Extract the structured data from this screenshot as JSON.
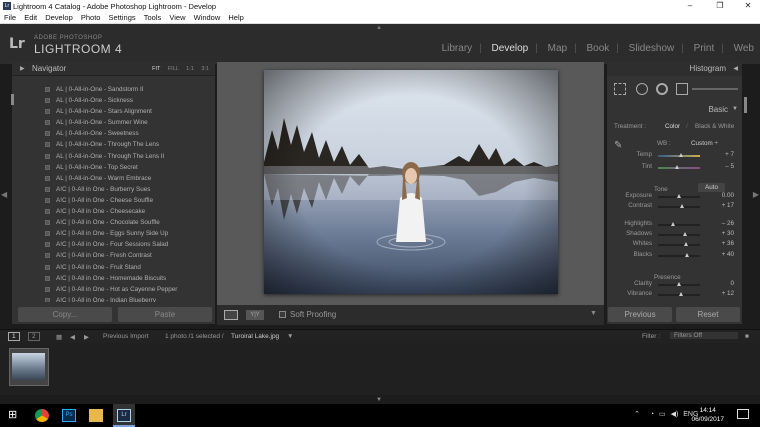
{
  "window": {
    "title": "Lightroom 4 Catalog - Adobe Photoshop Lightroom - Develop",
    "minimize": "–",
    "maximize": "❐",
    "close": "✕"
  },
  "menu": [
    "File",
    "Edit",
    "Develop",
    "Photo",
    "Settings",
    "Tools",
    "View",
    "Window",
    "Help"
  ],
  "identity": {
    "logo": "Lr",
    "brand": "ADOBE PHOTOSHOP",
    "product": "LIGHTROOM 4"
  },
  "modules": [
    "Library",
    "Develop",
    "Map",
    "Book",
    "Slideshow",
    "Print",
    "Web"
  ],
  "active_module": "Develop",
  "navigator": {
    "title": "Navigator",
    "zoom": [
      "FIT",
      "FILL",
      "1:1",
      "3:1"
    ]
  },
  "presets": [
    "AL | 0-All-in-One - Sandstorm II",
    "AL | 0-All-in-One - Sickness",
    "AL | 0-All-in-One - Stars Alignment",
    "AL | 0-All-in-One - Summer Wine",
    "AL | 0-All-in-One - Sweetness",
    "AL | 0-All-in-One - Through The Lens",
    "AL | 0-All-in-One - Through The Lens II",
    "AL | 0-All-in-One - Top Secret",
    "AL | 0-All-in-One - Warm Embrace",
    "A!C | 0-All in One - Burberry Sues",
    "A!C | 0-All in One - Cheese Souffle",
    "A!C | 0-All in One - Cheesecake",
    "A!C | 0-All in One - Chocolate Souffle",
    "A!C | 0-All in One - Eggs Sunny Side Up",
    "A!C | 0-All in One - Four Sessions Salad",
    "A!C | 0-All in One - Fresh Contrast",
    "A!C | 0-All in One - Fruit Stand",
    "A!C | 0-All in One - Homemade Biscuits",
    "A!C | 0-All in One - Hot as Cayenne Pepper",
    "A!C | 0-All in One - Indian Blueberry"
  ],
  "left_buttons": {
    "copy": "Copy...",
    "paste": "Paste"
  },
  "toolbar": {
    "soft_proofing": "Soft Proofing",
    "yy": "Y|Y"
  },
  "histogram": {
    "title": "Histogram"
  },
  "basic": {
    "title": "Basic",
    "treatment_label": "Treatment :",
    "treatment_color": "Color",
    "treatment_bw": "Black & White",
    "wb_label": "WB :",
    "wb_value": "Custom ÷",
    "tone_label": "Tone",
    "auto": "Auto",
    "presence_label": "Presence"
  },
  "sliders": [
    {
      "label": "Temp",
      "value": "+ 7",
      "pos": 0.55,
      "style": "wb"
    },
    {
      "label": "Tint",
      "value": "– 5",
      "pos": 0.47,
      "style": "tint"
    },
    {
      "label": "Exposure",
      "value": "0.00",
      "pos": 0.5,
      "style": ""
    },
    {
      "label": "Contrast",
      "value": "+ 17",
      "pos": 0.58,
      "style": ""
    },
    {
      "label": "Highlights",
      "value": "– 26",
      "pos": 0.37,
      "style": ""
    },
    {
      "label": "Shadows",
      "value": "+ 30",
      "pos": 0.65,
      "style": ""
    },
    {
      "label": "Whites",
      "value": "+ 36",
      "pos": 0.68,
      "style": ""
    },
    {
      "label": "Blacks",
      "value": "+ 40",
      "pos": 0.7,
      "style": ""
    },
    {
      "label": "Clarity",
      "value": "0",
      "pos": 0.5,
      "style": ""
    },
    {
      "label": "Vibrance",
      "value": "+ 12",
      "pos": 0.56,
      "style": ""
    }
  ],
  "right_buttons": {
    "previous": "Previous",
    "reset": "Reset"
  },
  "filmbar": {
    "page1": "1",
    "page2": "2",
    "source": "Previous Import",
    "selection": "1 photo /1 selected /",
    "filename": "Turoiral Lake.jpg",
    "filter_label": "Filter :",
    "filter_value": "Filters Off"
  },
  "taskbar": {
    "lang": "ENG",
    "time": "14:14",
    "date": "06/09/2017"
  },
  "colors": {
    "panel": "#333333",
    "accent": "#dddddd",
    "taskbar": "#000000"
  }
}
